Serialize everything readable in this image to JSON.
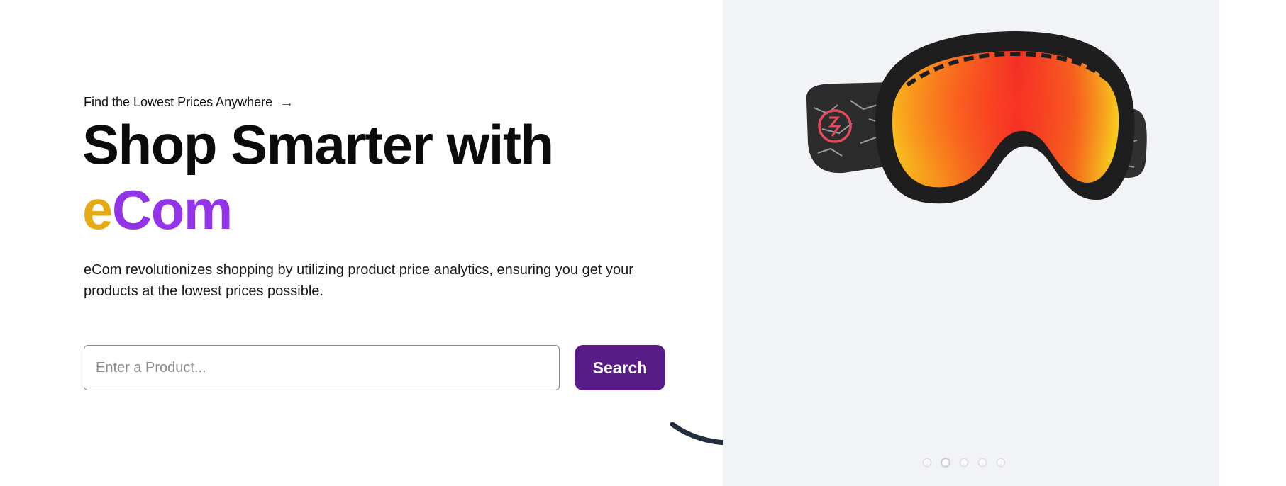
{
  "hero": {
    "eyebrow": "Find the Lowest Prices Anywhere",
    "eyebrow_icon": "arrow-right-icon",
    "headline_line1": "Shop Smarter with",
    "brand_e": "e",
    "brand_com": "Com",
    "description": "eCom revolutionizes shopping by utilizing product price analytics, ensuring you get your products at the lowest prices possible."
  },
  "search": {
    "placeholder": "Enter a Product...",
    "value": "",
    "button_label": "Search"
  },
  "carousel": {
    "product_icon": "ski-goggles-image",
    "slide_count": 5,
    "active_index": 1
  },
  "colors": {
    "accent_yellow": "#e4ab14",
    "accent_purple": "#9333ea",
    "button_purple": "#581c87",
    "panel_bg": "#f2f3f6",
    "logo_dark": "#232f3e"
  }
}
